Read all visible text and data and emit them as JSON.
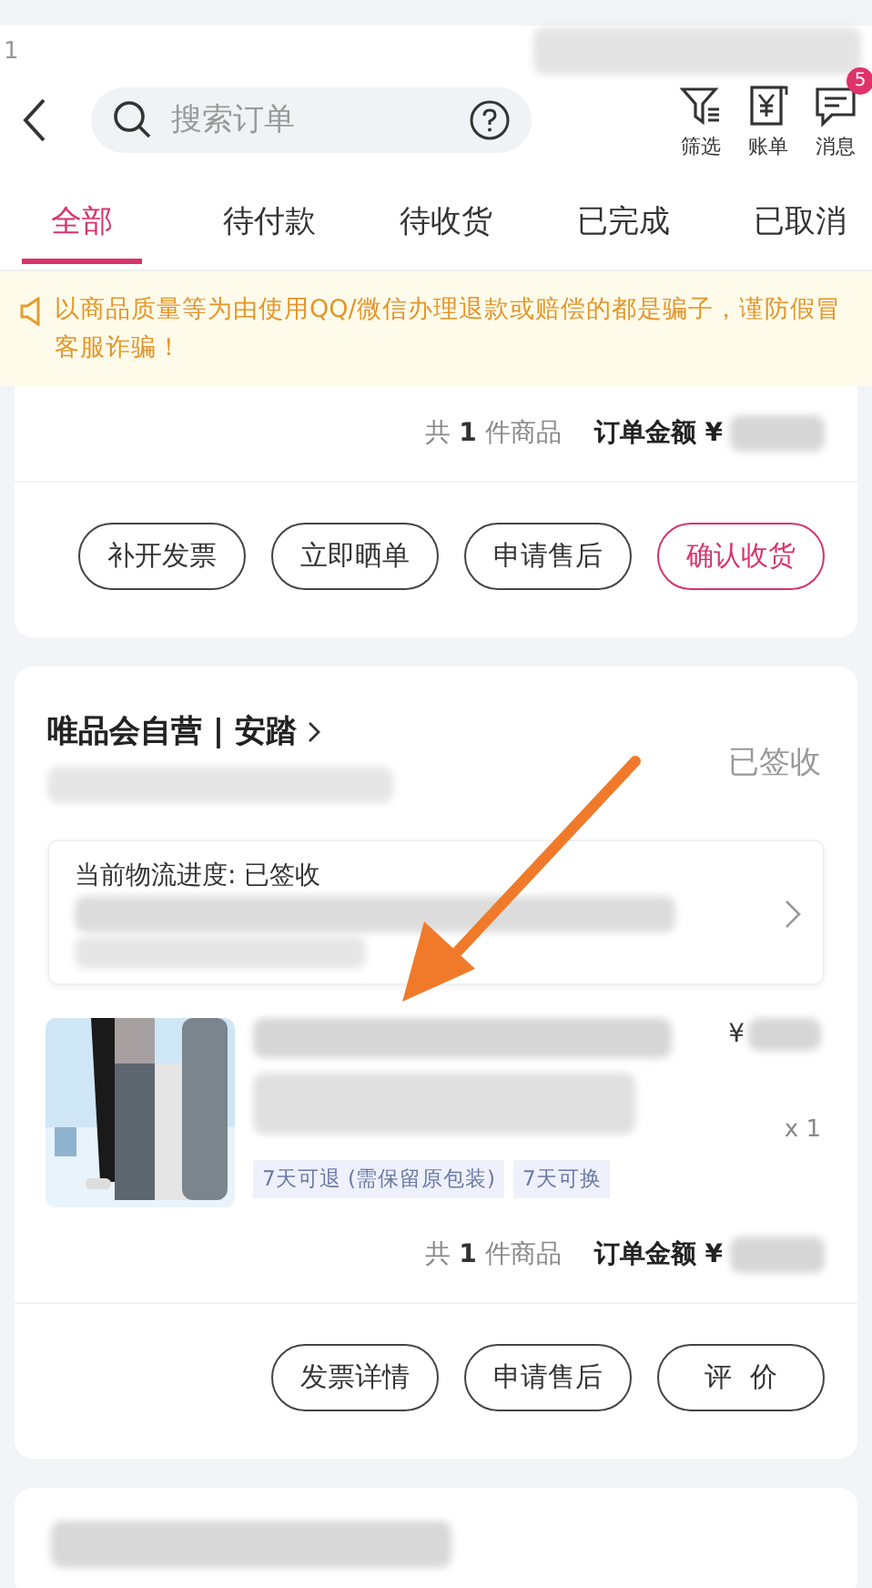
{
  "status_bar": {
    "time": "1"
  },
  "search": {
    "placeholder": "搜索订单"
  },
  "header_actions": [
    {
      "kind": "filter",
      "label": "筛选"
    },
    {
      "kind": "bill",
      "label": "账单"
    },
    {
      "kind": "message",
      "label": "消息",
      "badge": "5"
    }
  ],
  "tabs": [
    {
      "label": "全部",
      "selected": true
    },
    {
      "label": "待付款",
      "selected": false
    },
    {
      "label": "待收货",
      "selected": false
    },
    {
      "label": "已完成",
      "selected": false
    },
    {
      "label": "已取消",
      "selected": false
    }
  ],
  "notice": "以商品质量等为由使用QQ/微信办理退款或赔偿的都是骗子，谨防假冒客服诈骗！",
  "orders": [
    {
      "count": "共 **1** 件商品",
      "amount_label": "订单金额 ¥",
      "buttons": [
        {
          "label": "补开发票",
          "highlighted": false
        },
        {
          "label": "立即晒单",
          "highlighted": false
        },
        {
          "label": "申请售后",
          "highlighted": false
        },
        {
          "label": "确认收货",
          "highlighted": true
        }
      ]
    },
    {
      "shop": "唯品会自营 | 安踏",
      "status": "已签收",
      "logistics": "当前物流进度: 已签收",
      "product": {
        "kind": "picture",
        "price": "¥",
        "quantity": "x 1",
        "tags": [
          "7天可退 (需保留原包装)",
          "7天可换"
        ]
      },
      "count": "共 **1** 件商品",
      "amount_label": "订单金额 ¥",
      "buttons": [
        {
          "label": "发票详情",
          "highlighted": false
        },
        {
          "label": "申请售后",
          "highlighted": false
        },
        {
          "label": "评  价",
          "highlighted": false
        }
      ]
    }
  ]
}
